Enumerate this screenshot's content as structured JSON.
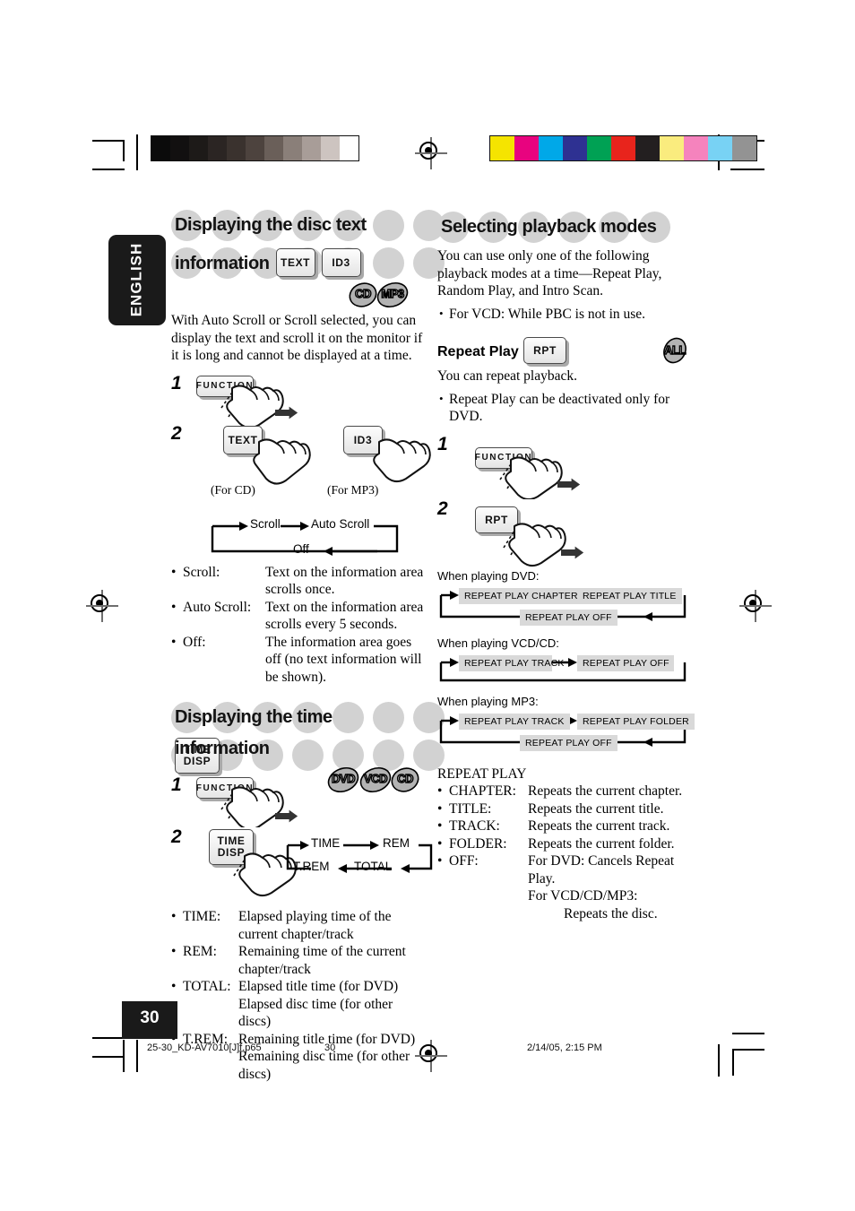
{
  "page": {
    "language_tab": "ENGLISH",
    "page_number": "30",
    "footer_filename": "25-30_KD-AV7010[J]f.p65",
    "footer_pagenum": "30",
    "footer_timestamp": "2/14/05, 2:15 PM"
  },
  "colorbars": {
    "grayscale": [
      "#0b0b0b",
      "#121010",
      "#1d1a18",
      "#2b2523",
      "#3a322e",
      "#4d433e",
      "#6a5f59",
      "#8a7f79",
      "#a89d98",
      "#cdc4c0",
      "#ffffff"
    ],
    "spot": [
      "#f5e400",
      "#e8037f",
      "#00a8e8",
      "#2e3192",
      "#00a154",
      "#e8241c",
      "#231f20",
      "#faec7e",
      "#f583bd",
      "#78d2f4",
      "#939393"
    ]
  },
  "left_column": {
    "section1": {
      "heading_line1": "Displaying the disc text",
      "heading_line2": "information",
      "keys": [
        "TEXT",
        "ID3"
      ],
      "discs": [
        "CD",
        "MP3"
      ],
      "intro": "With Auto Scroll or Scroll selected, you can display the text and scroll it on the monitor if it is long and cannot be displayed at a time.",
      "steps": [
        {
          "num": "1",
          "key": "FUNCTION"
        },
        {
          "num": "2",
          "key_cd": "TEXT",
          "key_mp3": "ID3",
          "label_cd": "(For CD)",
          "label_mp3": "(For MP3)"
        }
      ],
      "cycle": [
        "Scroll",
        "Auto Scroll",
        "Off"
      ],
      "definitions": [
        {
          "term": "Scroll:",
          "desc": "Text on the information area scrolls once."
        },
        {
          "term": "Auto Scroll:",
          "desc": "Text on the information area scrolls every 5 seconds."
        },
        {
          "term": "Off:",
          "desc": "The information area goes off (no text information will be shown)."
        }
      ]
    },
    "section2": {
      "heading": "Displaying the time information",
      "key": "TIME DISP",
      "key_line1": "TIME",
      "key_line2": "DISP",
      "discs": [
        "DVD",
        "VCD",
        "CD"
      ],
      "steps": [
        {
          "num": "1",
          "key": "FUNCTION"
        },
        {
          "num": "2",
          "key_line1": "TIME",
          "key_line2": "DISP"
        }
      ],
      "cycle": [
        "TIME",
        "REM",
        "TOTAL",
        "T.REM"
      ],
      "definitions": [
        {
          "term": "TIME:",
          "desc": "Elapsed playing time of the current chapter/track"
        },
        {
          "term": "REM:",
          "desc": "Remaining time of the current chapter/track"
        },
        {
          "term": "TOTAL:",
          "desc": "Elapsed title time (for DVD) Elapsed disc time (for other discs)"
        },
        {
          "term": "T.REM:",
          "desc": "Remaining title time (for DVD) Remaining disc time (for other discs)"
        }
      ]
    }
  },
  "right_column": {
    "heading": "Selecting playback modes",
    "intro": "You can use only one of the following playback modes at a time—Repeat Play, Random Play, and Intro Scan.",
    "intro_bullet": "For VCD: While PBC is not in use.",
    "repeat": {
      "title": "Repeat Play",
      "key": "RPT",
      "disc": "ALL",
      "line1": "You can repeat playback.",
      "bullet1": "Repeat Play can be deactivated only for DVD.",
      "steps": [
        {
          "num": "1",
          "key": "FUNCTION"
        },
        {
          "num": "2",
          "key": "RPT"
        }
      ],
      "diagrams": [
        {
          "caption": "When playing DVD:",
          "top": [
            "REPEAT PLAY CHAPTER",
            "REPEAT PLAY TITLE"
          ],
          "bottom": "REPEAT PLAY OFF"
        },
        {
          "caption": "When playing VCD/CD:",
          "top": [
            "REPEAT PLAY TRACK",
            "REPEAT PLAY OFF"
          ],
          "bottom": ""
        },
        {
          "caption": "When playing MP3:",
          "top": [
            "REPEAT PLAY TRACK",
            "REPEAT PLAY FOLDER"
          ],
          "bottom": "REPEAT PLAY OFF"
        }
      ],
      "legend_title": "REPEAT PLAY",
      "legend": [
        {
          "term": "CHAPTER:",
          "desc": "Repeats the current chapter."
        },
        {
          "term": "TITLE:",
          "desc": "Repeats the current title."
        },
        {
          "term": "TRACK:",
          "desc": "Repeats the current track."
        },
        {
          "term": "FOLDER:",
          "desc": "Repeats the current folder."
        },
        {
          "term": "OFF:",
          "desc": "For DVD: Cancels Repeat Play.",
          "desc2": "For VCD/CD/MP3:",
          "desc3": "Repeats the disc."
        }
      ]
    }
  }
}
